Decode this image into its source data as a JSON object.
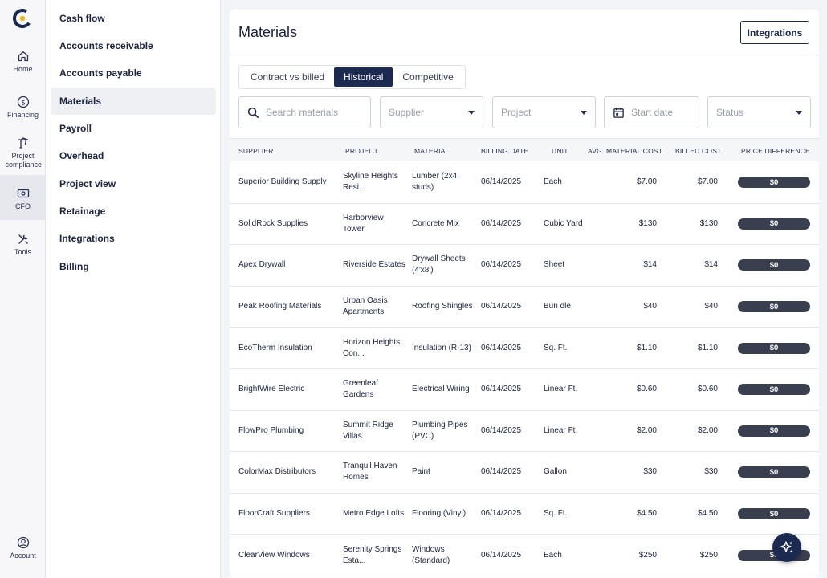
{
  "rail": {
    "items": [
      {
        "label": "Home",
        "icon": "home-icon"
      },
      {
        "label": "Financing",
        "icon": "dollar-circle-icon"
      },
      {
        "label": "Project compliance",
        "icon": "crane-icon"
      },
      {
        "label": "CFO",
        "icon": "cash-icon"
      },
      {
        "label": "Tools",
        "icon": "tools-icon"
      }
    ],
    "account": {
      "label": "Account",
      "icon": "account-icon"
    }
  },
  "submenu": {
    "items": [
      {
        "label": "Cash flow"
      },
      {
        "label": "Accounts receivable"
      },
      {
        "label": "Accounts payable"
      },
      {
        "label": "Materials"
      },
      {
        "label": "Payroll"
      },
      {
        "label": "Overhead"
      },
      {
        "label": "Project view"
      },
      {
        "label": "Retainage"
      },
      {
        "label": "Integrations"
      },
      {
        "label": "Billing"
      }
    ],
    "active": "Materials"
  },
  "main": {
    "title": "Materials",
    "integrations_button": "Integrations",
    "tabs": [
      "Contract vs billed",
      "Historical",
      "Competitive"
    ],
    "active_tab": "Historical",
    "filters": {
      "search_placeholder": "Search materials",
      "supplier": "Supplier",
      "project": "Project",
      "start_date": "Start date",
      "status": "Status"
    }
  },
  "table": {
    "columns": [
      "SUPPLIER",
      "PROJECT",
      "MATERIAL",
      "BILLING DATE",
      "UNIT",
      "AVG. MATERIAL COST",
      "BILLED COST",
      "PRICE DIFFERENCE"
    ],
    "rows": [
      {
        "supplier": "Superior Building Supply",
        "project": "Skyline Heights Resi...",
        "material": "Lumber (2x4 studs)",
        "date": "06/14/2025",
        "unit": "Each",
        "avg": "$7.00",
        "billed": "$7.00",
        "diff": "$0"
      },
      {
        "supplier": "SolidRock Supplies",
        "project": "Harborview Tower",
        "material": "Concrete Mix",
        "date": "06/14/2025",
        "unit": "Cubic Yard",
        "avg": "$130",
        "billed": "$130",
        "diff": "$0"
      },
      {
        "supplier": "Apex Drywall",
        "project": "Riverside Estates",
        "material": "Drywall Sheets (4'x8')",
        "date": "06/14/2025",
        "unit": "Sheet",
        "avg": "$14",
        "billed": "$14",
        "diff": "$0"
      },
      {
        "supplier": "Peak Roofing Materials",
        "project": "Urban Oasis Apartments",
        "material": "Roofing Shingles",
        "date": "06/14/2025",
        "unit": "Bun dle",
        "avg": "$40",
        "billed": "$40",
        "diff": "$0"
      },
      {
        "supplier": "EcoTherm Insulation",
        "project": "Horizon Heights Con...",
        "material": "Insulation (R-13)",
        "date": "06/14/2025",
        "unit": "Sq. Ft.",
        "avg": "$1.10",
        "billed": "$1.10",
        "diff": "$0"
      },
      {
        "supplier": "BrightWire Electric",
        "project": "Greenleaf Gardens",
        "material": "Electrical Wiring",
        "date": "06/14/2025",
        "unit": "Linear Ft.",
        "avg": "$0.60",
        "billed": "$0.60",
        "diff": "$0"
      },
      {
        "supplier": "FlowPro Plumbing",
        "project": "Summit Ridge Villas",
        "material": "Plumbing Pipes (PVC)",
        "date": "06/14/2025",
        "unit": "Linear Ft.",
        "avg": "$2.00",
        "billed": "$2.00",
        "diff": "$0"
      },
      {
        "supplier": "ColorMax Distributors",
        "project": "Tranquil Haven Homes",
        "material": "Paint",
        "date": "06/14/2025",
        "unit": "Gallon",
        "avg": "$30",
        "billed": "$30",
        "diff": "$0"
      },
      {
        "supplier": "FloorCraft Suppliers",
        "project": "Metro Edge Lofts",
        "material": "Flooring (Vinyl)",
        "date": "06/14/2025",
        "unit": "Sq. Ft.",
        "avg": "$4.50",
        "billed": "$4.50",
        "diff": "$0"
      },
      {
        "supplier": "ClearView Windows",
        "project": "Serenity Springs Esta...",
        "material": "Windows (Standard)",
        "date": "06/14/2025",
        "unit": "Each",
        "avg": "$250",
        "billed": "$250",
        "diff": "$0"
      }
    ]
  },
  "fab": {
    "icon": "sparkle-icon"
  },
  "colors": {
    "accent": "#1c2a52",
    "pill": "#3a3f4f",
    "logo_yellow": "#f2b51c"
  }
}
